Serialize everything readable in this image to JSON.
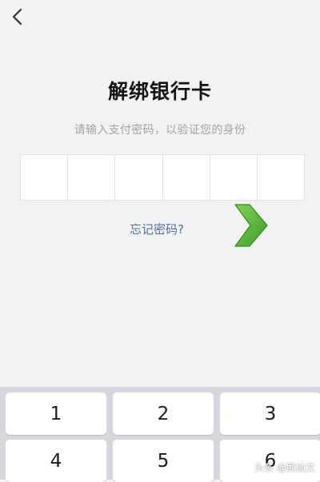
{
  "header": {
    "back_icon": "chevron-left-icon",
    "title": "解绑银行卡",
    "subtitle": "请输入支付密码，以验证您的身份"
  },
  "pin": {
    "length": 6,
    "filled": 0
  },
  "forgot_password": {
    "label": "忘记密码?"
  },
  "overlay": {
    "icon": "green-arrow-right-icon",
    "color": "#4cae2f"
  },
  "keypad": {
    "keys": [
      "1",
      "2",
      "3",
      "4",
      "5",
      "6"
    ]
  },
  "watermark": {
    "text": "头条 @脆仙文"
  },
  "colors": {
    "background": "#f2f2f2",
    "keypad_background": "#d5d7dc",
    "link": "#53709c",
    "subtitle": "#a3a3a3"
  }
}
